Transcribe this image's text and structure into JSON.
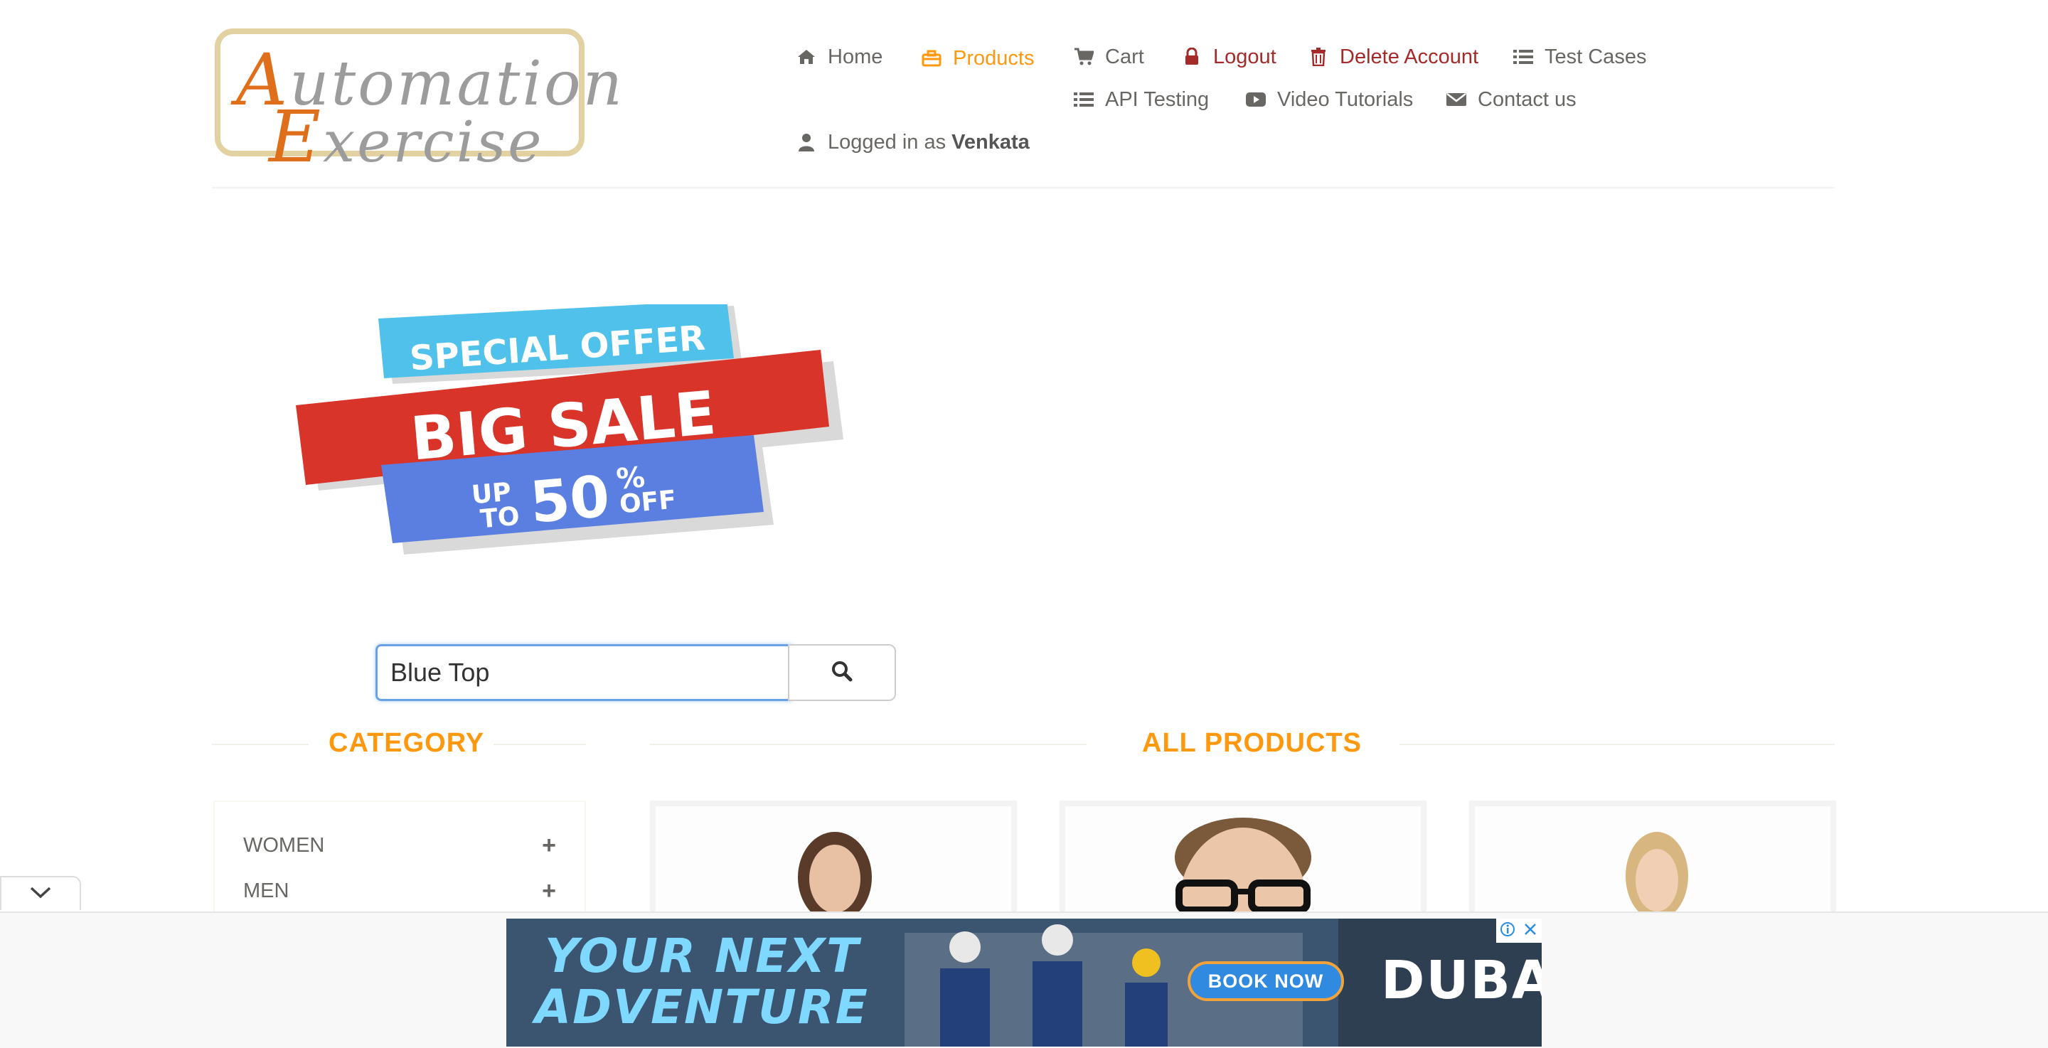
{
  "logo": {
    "line1": "Automation",
    "line2": "Exercise",
    "cap1": "A",
    "rest1": "utomation",
    "cap2": "E",
    "rest2": "xercise"
  },
  "nav": {
    "home": "Home",
    "products": "Products",
    "cart": "Cart",
    "logout": "Logout",
    "delete_account": "Delete Account",
    "test_cases": "Test Cases",
    "api_testing": "API Testing",
    "video_tutorials": "Video Tutorials",
    "contact_us": "Contact us",
    "logged_in_prefix": "Logged in as",
    "username": "Venkata"
  },
  "colors": {
    "accent": "#fe980f",
    "danger": "#a52a2a",
    "text": "#696763",
    "focus": "#6aa1e5"
  },
  "banner": {
    "line1": "SPECIAL OFFER",
    "line2": "BIG SALE",
    "up": "UP",
    "to": "TO",
    "percent": "50",
    "pct_sign": "%",
    "off": "OFF"
  },
  "search": {
    "value": "Blue Top",
    "button_icon": "search-icon"
  },
  "category": {
    "title": "CATEGORY",
    "items": [
      {
        "label": "WOMEN"
      },
      {
        "label": "MEN"
      }
    ]
  },
  "products": {
    "title": "ALL PRODUCTS"
  },
  "ad": {
    "headline1": "YOUR NEXT",
    "headline2": "ADVENTURE",
    "cta": "BOOK NOW",
    "brand": "DUBAI"
  }
}
